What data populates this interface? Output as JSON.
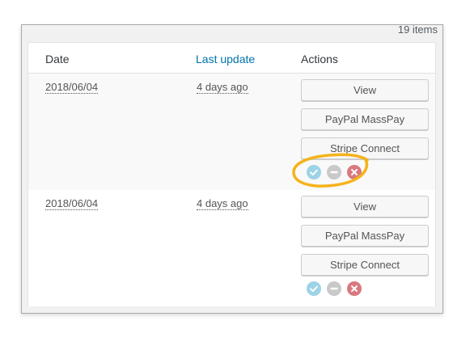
{
  "pagination": {
    "items_count": "19 items"
  },
  "table": {
    "headers": {
      "date": "Date",
      "last_update": "Last update",
      "actions": "Actions"
    },
    "rows": [
      {
        "date": "2018/06/04",
        "last_update": "4 days ago",
        "buttons": {
          "view": "View",
          "paypal": "PayPal MassPay",
          "stripe": "Stripe Connect"
        },
        "status_icons": [
          "approve-icon",
          "pause-icon",
          "reject-icon"
        ]
      },
      {
        "date": "2018/06/04",
        "last_update": "4 days ago",
        "buttons": {
          "view": "View",
          "paypal": "PayPal MassPay",
          "stripe": "Stripe Connect"
        },
        "status_icons": [
          "approve-icon",
          "pause-icon",
          "reject-icon"
        ]
      }
    ]
  },
  "colors": {
    "link": "#0073aa",
    "approve": "#9cd3e6",
    "pause": "#c9c9c9",
    "reject": "#d9797f",
    "highlight": "#f5b31a"
  }
}
